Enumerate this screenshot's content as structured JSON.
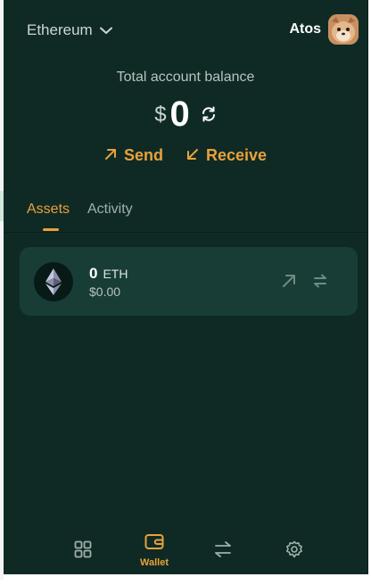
{
  "header": {
    "network": "Ethereum",
    "account_name": "Atos"
  },
  "balance": {
    "label": "Total account balance",
    "currency_symbol": "$",
    "value": "0"
  },
  "actions": {
    "send": "Send",
    "receive": "Receive"
  },
  "tabs": [
    {
      "label": "Assets",
      "active": true
    },
    {
      "label": "Activity",
      "active": false
    }
  ],
  "assets": [
    {
      "amount": "0",
      "symbol": "ETH",
      "fiat": "$0.00",
      "icon": "ethereum-icon"
    }
  ],
  "bottom_nav": {
    "items": [
      {
        "name": "apps",
        "icon": "grid-icon",
        "label": ""
      },
      {
        "name": "wallet",
        "icon": "wallet-icon",
        "label": "Wallet",
        "active": true
      },
      {
        "name": "swap",
        "icon": "swap-arrows-icon",
        "label": ""
      },
      {
        "name": "settings",
        "icon": "gear-icon",
        "label": ""
      }
    ]
  },
  "colors": {
    "background": "#0f2a25",
    "card": "#173d36",
    "accent": "#e9a13a",
    "muted_text": "#9fb0ab"
  }
}
